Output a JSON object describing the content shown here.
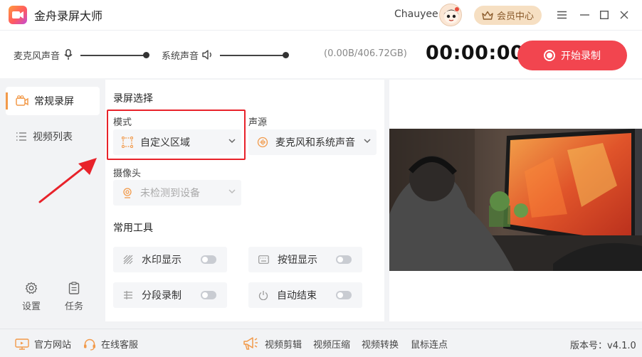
{
  "app": {
    "title": "金舟录屏大师"
  },
  "header": {
    "username": "Chauyee",
    "vip_label": "会员中心"
  },
  "audio": {
    "mic_label": "麦克风声音",
    "mic_level": 1.0,
    "system_label": "系统声音",
    "system_level": 1.0,
    "disk_info": "(0.00B/406.72GB)",
    "timer": "00:00:00",
    "record_label": "开始录制"
  },
  "sidebar": {
    "items": [
      {
        "label": "常规录屏",
        "icon": "camera-icon",
        "active": true
      },
      {
        "label": "视频列表",
        "icon": "list-icon",
        "active": false
      }
    ],
    "settings_label": "设置",
    "tasks_label": "任务"
  },
  "panel": {
    "section_record": "录屏选择",
    "mode_label": "模式",
    "mode_value": "自定义区域",
    "source_label": "声源",
    "source_value": "麦克风和系统声音",
    "camera_label": "摄像头",
    "camera_value": "未检测到设备",
    "section_tools": "常用工具",
    "tools": [
      {
        "label": "水印显示",
        "icon": "watermark-icon",
        "on": false
      },
      {
        "label": "按钮显示",
        "icon": "keyboard-icon",
        "on": false
      },
      {
        "label": "分段录制",
        "icon": "segment-icon",
        "on": false
      },
      {
        "label": "自动结束",
        "icon": "power-icon",
        "on": false
      }
    ]
  },
  "footer": {
    "website": "官方网站",
    "support": "在线客服",
    "edit": "视频剪辑",
    "compress": "视频压缩",
    "convert": "视频转换",
    "click": "鼠标连点",
    "version": "版本号：v4.1.0"
  },
  "colors": {
    "accent": "#f2454f",
    "highlight": "#e8222a",
    "icon_orange": "#f29a4a"
  }
}
